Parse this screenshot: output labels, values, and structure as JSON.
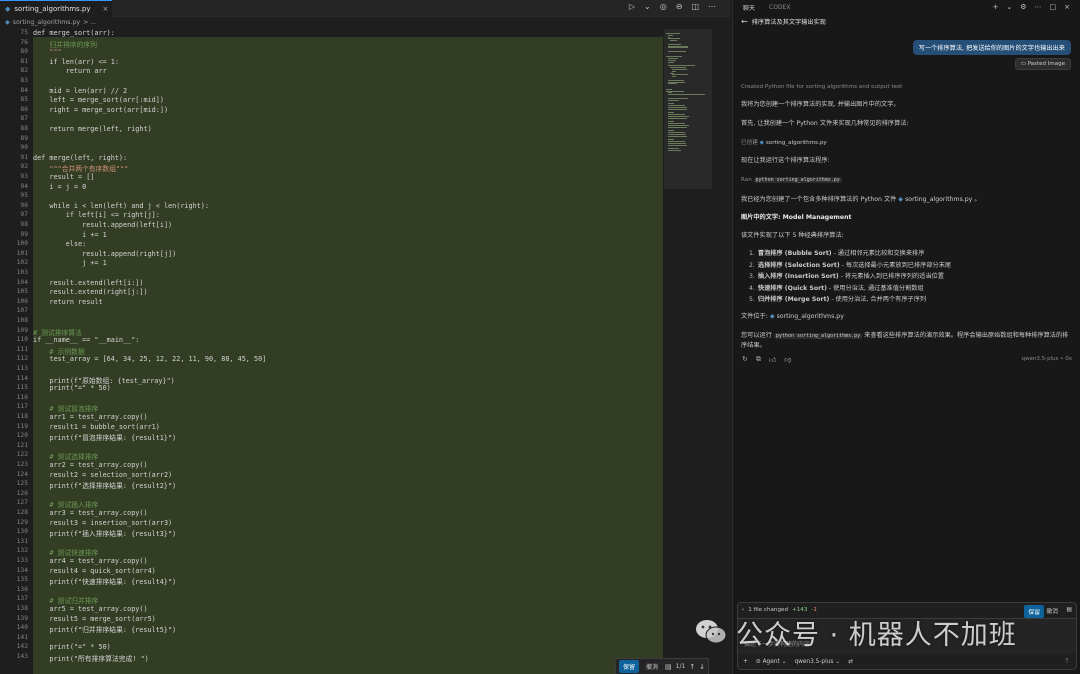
{
  "editor": {
    "tab_name": "sorting_algorithms.py",
    "tab_close": "×",
    "breadcrumb_file": "sorting_algorithms.py",
    "breadcrumb_more": "> ...",
    "toolbar_icons": [
      "run-icon",
      "split-icon",
      "copilot-icon",
      "compare-icon",
      "split-editor-icon",
      "more-icon"
    ],
    "line_numbers": [
      "75",
      "76",
      "80",
      "81",
      "82",
      "83",
      "84",
      "85",
      "86",
      "87",
      "88",
      "89",
      "90",
      "91",
      "92",
      "93",
      "94",
      "95",
      "96",
      "97",
      "98",
      "99",
      "100",
      "101",
      "102",
      "103",
      "104",
      "105",
      "106",
      "107",
      "108",
      "109",
      "110",
      "111",
      "112",
      "113",
      "114",
      "115",
      "116",
      "117",
      "118",
      "119",
      "120",
      "121",
      "122",
      "123",
      "124",
      "125",
      "126",
      "127",
      "128",
      "129",
      "130",
      "131",
      "132",
      "133",
      "134",
      "135",
      "136",
      "137",
      "138",
      "139",
      "140",
      "141",
      "142",
      "143"
    ],
    "code_lines": [
      {
        "t": "def merge_sort(arr):",
        "k": "def"
      },
      {
        "t": "    归并排序的序列",
        "k": "cm"
      },
      {
        "t": "    \"\"\"",
        "k": "st"
      },
      {
        "t": "    if len(arr) <= 1:",
        "k": "kw"
      },
      {
        "t": "        return arr",
        "k": "kw"
      },
      {
        "t": "",
        "k": ""
      },
      {
        "t": "    mid = len(arr) // 2",
        "k": ""
      },
      {
        "t": "    left = merge_sort(arr[:mid])",
        "k": ""
      },
      {
        "t": "    right = merge_sort(arr[mid:])",
        "k": ""
      },
      {
        "t": "",
        "k": ""
      },
      {
        "t": "    return merge(left, right)",
        "k": "kw"
      },
      {
        "t": "",
        "k": ""
      },
      {
        "t": "",
        "k": ""
      },
      {
        "t": "def merge(left, right):",
        "k": "def"
      },
      {
        "t": "    \"\"\"合并两个有序数组\"\"\"",
        "k": "st"
      },
      {
        "t": "    result = []",
        "k": ""
      },
      {
        "t": "    i = j = 0",
        "k": ""
      },
      {
        "t": "",
        "k": ""
      },
      {
        "t": "    while i < len(left) and j < len(right):",
        "k": "kw"
      },
      {
        "t": "        if left[i] <= right[j]:",
        "k": "kw"
      },
      {
        "t": "            result.append(left[i])",
        "k": ""
      },
      {
        "t": "            i += 1",
        "k": ""
      },
      {
        "t": "        else:",
        "k": "kw"
      },
      {
        "t": "            result.append(right[j])",
        "k": ""
      },
      {
        "t": "            j += 1",
        "k": ""
      },
      {
        "t": "",
        "k": ""
      },
      {
        "t": "    result.extend(left[i:])",
        "k": ""
      },
      {
        "t": "    result.extend(right[j:])",
        "k": ""
      },
      {
        "t": "    return result",
        "k": "kw"
      },
      {
        "t": "",
        "k": ""
      },
      {
        "t": "",
        "k": ""
      },
      {
        "t": "# 测试排序算法",
        "k": "cm"
      },
      {
        "t": "if __name__ == \"__main__\":",
        "k": "kw"
      },
      {
        "t": "    # 示例数据",
        "k": "cm"
      },
      {
        "t": "    test_array = [64, 34, 25, 12, 22, 11, 90, 88, 45, 50]",
        "k": ""
      },
      {
        "t": "",
        "k": ""
      },
      {
        "t": "    print(f\"原始数组: {test_array}\")",
        "k": ""
      },
      {
        "t": "    print(\"=\" * 50)",
        "k": ""
      },
      {
        "t": "",
        "k": ""
      },
      {
        "t": "    # 测试冒泡排序",
        "k": "cm"
      },
      {
        "t": "    arr1 = test_array.copy()",
        "k": ""
      },
      {
        "t": "    result1 = bubble_sort(arr1)",
        "k": ""
      },
      {
        "t": "    print(f\"冒泡排序结果: {result1}\")",
        "k": ""
      },
      {
        "t": "",
        "k": ""
      },
      {
        "t": "    # 测试选择排序",
        "k": "cm"
      },
      {
        "t": "    arr2 = test_array.copy()",
        "k": ""
      },
      {
        "t": "    result2 = selection_sort(arr2)",
        "k": ""
      },
      {
        "t": "    print(f\"选择排序结果: {result2}\")",
        "k": ""
      },
      {
        "t": "",
        "k": ""
      },
      {
        "t": "    # 测试插入排序",
        "k": "cm"
      },
      {
        "t": "    arr3 = test_array.copy()",
        "k": ""
      },
      {
        "t": "    result3 = insertion_sort(arr3)",
        "k": ""
      },
      {
        "t": "    print(f\"插入排序结果: {result3}\")",
        "k": ""
      },
      {
        "t": "",
        "k": ""
      },
      {
        "t": "    # 测试快速排序",
        "k": "cm"
      },
      {
        "t": "    arr4 = test_array.copy()",
        "k": ""
      },
      {
        "t": "    result4 = quick_sort(arr4)",
        "k": ""
      },
      {
        "t": "    print(f\"快速排序结果: {result4}\")",
        "k": ""
      },
      {
        "t": "",
        "k": ""
      },
      {
        "t": "    # 测试归并排序",
        "k": "cm"
      },
      {
        "t": "    arr5 = test_array.copy()",
        "k": ""
      },
      {
        "t": "    result5 = merge_sort(arr5)",
        "k": ""
      },
      {
        "t": "    print(f\"归并排序结果: {result5}\")",
        "k": ""
      },
      {
        "t": "",
        "k": ""
      },
      {
        "t": "    print(\"=\" * 50)",
        "k": ""
      },
      {
        "t": "    print(\"所有排序算法完成! \")",
        "k": ""
      }
    ],
    "diffbar": {
      "keep": "保留",
      "undo": "撤消",
      "count": "1/1"
    }
  },
  "chat": {
    "tab_chat": "聊天",
    "tab_codex": "CODEX",
    "title": "排序算法及其文字输出实现",
    "user_message": "写一个排序算法, 把发送给你的图片的文字也输出出来",
    "pasted_image": "Pasted Image",
    "created_note": "Created Python file for sorting algorithms and output text",
    "p1": "我将为您创建一个排序算法的实现, 并输出图片中的文字。",
    "p2": "首先, 让我创建一个 Python 文件来实现几种常见的排序算法:",
    "created_label": "已创建",
    "file_name": "sorting_algorithms.py",
    "p3": "现在让我运行这个排序算法程序:",
    "ran_label": "Ran",
    "ran_cmd": "python sorting_algorithms.py",
    "p4_a": "我已经为您创建了一个包含多种排序算法的 Python 文件",
    "p4_b": "。",
    "image_text_label": "图片中的文字:",
    "image_text_value": "Model Management",
    "p5": "该文件实现了以下 5 种经典排序算法:",
    "algorithms": [
      {
        "n": "1.",
        "name": "冒泡排序 (Bubble Sort)",
        "desc": " - 通过相邻元素比较和交换来排序"
      },
      {
        "n": "2.",
        "name": "选择排序 (Selection Sort)",
        "desc": " - 每次选择最小元素放到已排序部分末尾"
      },
      {
        "n": "3.",
        "name": "插入排序 (Insertion Sort)",
        "desc": " - 将元素插入到已排序序列的适当位置"
      },
      {
        "n": "4.",
        "name": "快速排序 (Quick Sort)",
        "desc": " - 使用分治法, 通过基准值分割数组"
      },
      {
        "n": "5.",
        "name": "归并排序 (Merge Sort)",
        "desc": " - 使用分治法, 合并两个有序子序列"
      }
    ],
    "file_location_label": "文件位于:",
    "p6_a": "您可以运行",
    "p6_cmd": "python sorting_algorithms.py",
    "p6_b": "来查看这些排序算法的演示效果。程序会输出原始数组和每种排序算法的排序结果。",
    "model_note": "qwen3.5-plus • 0x",
    "input": {
      "changed": "1 file changed",
      "plus": "+143",
      "minus": "-1",
      "keep": "保留",
      "undo": "撤消",
      "field_text": "描述下一步要构建的内容",
      "agent": "Agent",
      "model": "qwen3.5-plus"
    }
  },
  "watermark": {
    "text": "公众号 · 机器人不加班"
  },
  "colors": {
    "accent": "#0e639c",
    "highlight": "#333d24",
    "editor_bg": "#1e1e1e",
    "chat_bg": "#181818"
  }
}
